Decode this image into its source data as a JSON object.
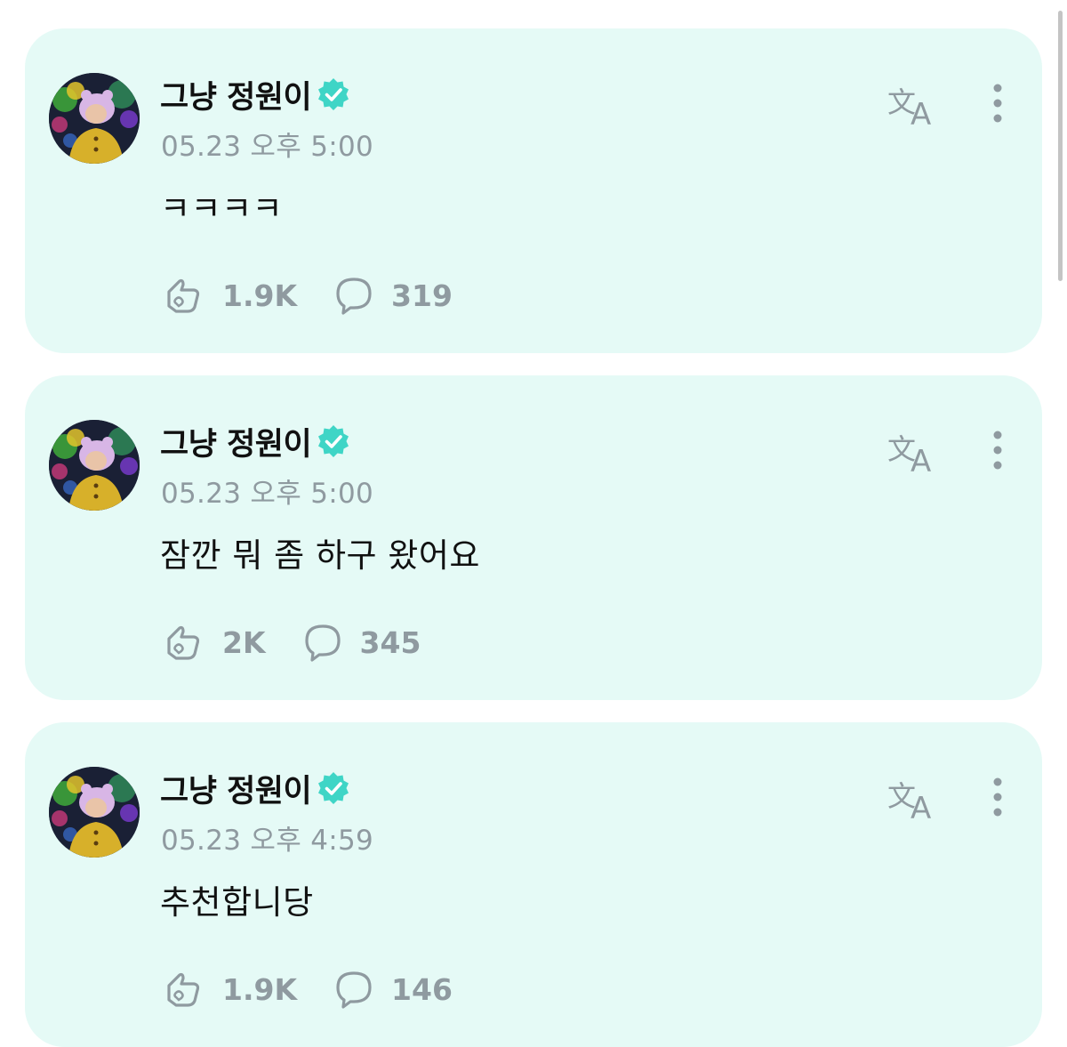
{
  "colors": {
    "card_background": "#e5faf6",
    "verified_badge": "#3fd5c6",
    "muted_text": "#8f9aa0",
    "primary_text": "#111111"
  },
  "icons": {
    "verified": "verified-badge-icon",
    "translate": "translate-icon",
    "more": "more-vertical-icon",
    "like": "like-icon",
    "comment": "comment-icon"
  },
  "posts": [
    {
      "author": "그냥 정원이",
      "timestamp": "05.23 오후 5:00",
      "text": "ㅋㅋㅋㅋ",
      "likes": "1.9K",
      "comments": "319"
    },
    {
      "author": "그냥 정원이",
      "timestamp": "05.23 오후 5:00",
      "text": "잠깐 뭐 좀 하구 왔어요",
      "likes": "2K",
      "comments": "345"
    },
    {
      "author": "그냥 정원이",
      "timestamp": "05.23 오후 4:59",
      "text": "추천합니당",
      "likes": "1.9K",
      "comments": "146"
    }
  ]
}
